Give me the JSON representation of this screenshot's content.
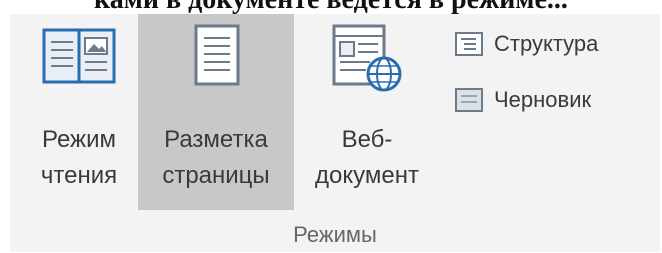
{
  "caption_fragment": "ками в документе ведется в режиме...",
  "ribbon": {
    "group_label": "Режимы",
    "modes": [
      {
        "line1": "Режим",
        "line2": "чтения",
        "icon": "read-mode-book-icon",
        "selected": false
      },
      {
        "line1": "Разметка",
        "line2": "страницы",
        "icon": "print-layout-page-icon",
        "selected": true
      },
      {
        "line1": "Веб-",
        "line2": "документ",
        "icon": "web-layout-globe-icon",
        "selected": false
      }
    ],
    "small_buttons": [
      {
        "label": "Структура",
        "icon": "outline-view-icon"
      },
      {
        "label": "Черновик",
        "icon": "draft-view-icon"
      }
    ]
  },
  "colors": {
    "ribbon_bg": "#f3f3f3",
    "selected_bg": "#c8c8c8",
    "icon_blue": "#2b6cb0",
    "text": "#3a3a3a"
  }
}
